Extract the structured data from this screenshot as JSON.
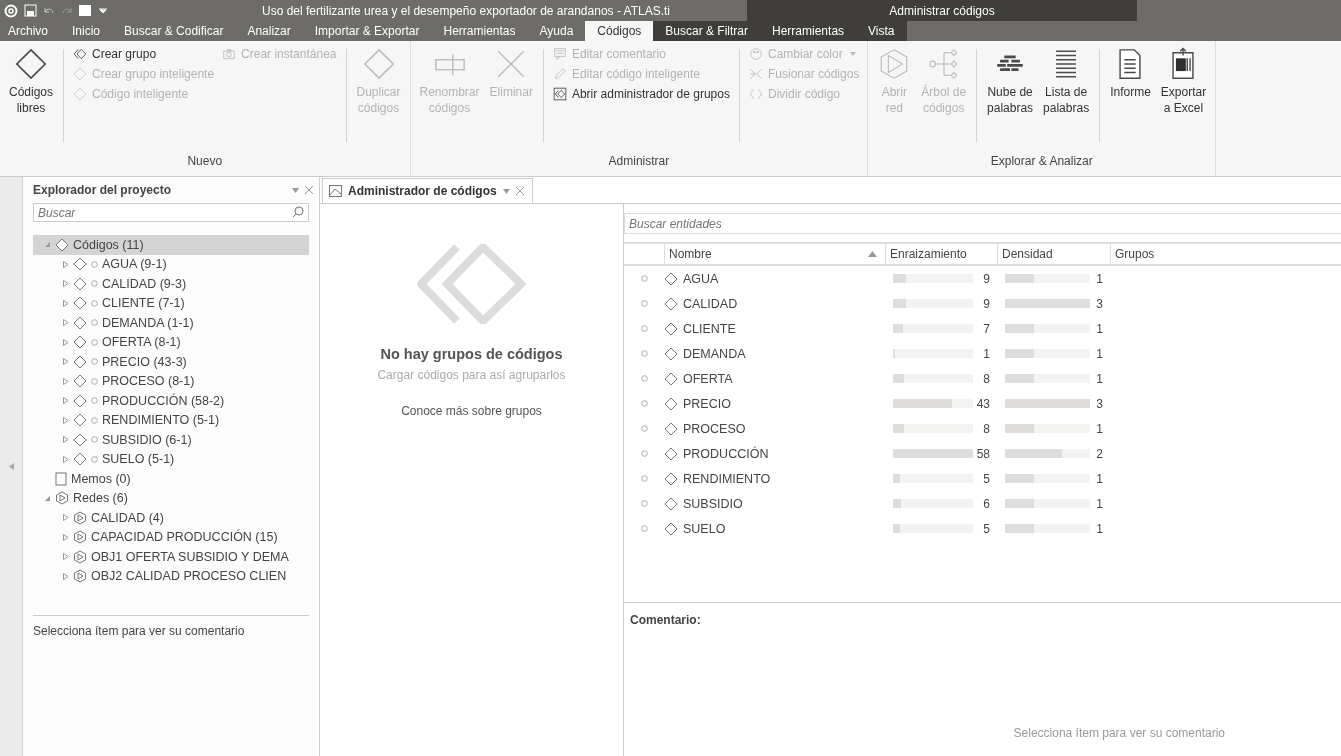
{
  "window": {
    "title": "Uso del fertilizante urea y el desempeño exportador de arandanos - ATLAS.ti",
    "context_title": "Administrar códigos"
  },
  "menu": [
    {
      "label": "Archivo",
      "selected": false,
      "context": false
    },
    {
      "label": "Inicio",
      "selected": false,
      "context": false
    },
    {
      "label": "Buscar & Codificar",
      "selected": false,
      "context": false
    },
    {
      "label": "Analizar",
      "selected": false,
      "context": false
    },
    {
      "label": "Importar & Exportar",
      "selected": false,
      "context": false
    },
    {
      "label": "Herramientas",
      "selected": false,
      "context": false
    },
    {
      "label": "Ayuda",
      "selected": false,
      "context": false
    },
    {
      "label": "Códigos",
      "selected": true,
      "context": true
    },
    {
      "label": "Buscar & Filtrar",
      "selected": false,
      "context": true
    },
    {
      "label": "Herramientas",
      "selected": false,
      "context": true
    },
    {
      "label": "Vista",
      "selected": false,
      "context": true
    }
  ],
  "ribbon": [
    {
      "label": "Nuevo",
      "columns": [
        {
          "kind": "large",
          "buttons": [
            {
              "label": "Códigos\nlibres",
              "disabled": false
            }
          ]
        },
        {
          "kind": "separator"
        },
        {
          "kind": "stack",
          "buttons": [
            {
              "label": "Crear grupo",
              "disabled": false
            },
            {
              "label": "Crear grupo inteligente",
              "disabled": true
            },
            {
              "label": "Código inteligente",
              "disabled": true
            }
          ]
        },
        {
          "kind": "stack",
          "buttons": [
            {
              "label": "Crear instantánea",
              "disabled": true
            }
          ]
        },
        {
          "kind": "separator"
        },
        {
          "kind": "large",
          "buttons": [
            {
              "label": "Duplicar\ncódigos",
              "disabled": true
            }
          ]
        }
      ]
    },
    {
      "label": "Administrar",
      "columns": [
        {
          "kind": "large",
          "buttons": [
            {
              "label": "Renombrar\ncódigos",
              "disabled": true
            }
          ]
        },
        {
          "kind": "large",
          "buttons": [
            {
              "label": "Eliminar",
              "disabled": true
            }
          ]
        },
        {
          "kind": "separator"
        },
        {
          "kind": "stack",
          "buttons": [
            {
              "label": "Editar comentario",
              "disabled": true
            },
            {
              "label": "Editar código inteligente",
              "disabled": true
            },
            {
              "label": "Abrir administrador de grupos",
              "disabled": false
            }
          ]
        },
        {
          "kind": "separator"
        },
        {
          "kind": "stack",
          "buttons": [
            {
              "label": "Cambiar color",
              "disabled": true,
              "dropdown": true
            },
            {
              "label": "Fusionar códigos",
              "disabled": true
            },
            {
              "label": "Dividir código",
              "disabled": true
            }
          ]
        }
      ]
    },
    {
      "label": "Explorar & Analizar",
      "columns": [
        {
          "kind": "large",
          "buttons": [
            {
              "label": "Abrir\nred",
              "disabled": true
            }
          ]
        },
        {
          "kind": "large",
          "buttons": [
            {
              "label": "Árbol de\ncódigos",
              "disabled": true
            }
          ]
        },
        {
          "kind": "separator"
        },
        {
          "kind": "large",
          "buttons": [
            {
              "label": "Nube de\npalabras",
              "disabled": false
            }
          ]
        },
        {
          "kind": "large",
          "buttons": [
            {
              "label": "Lista de\npalabras",
              "disabled": false
            }
          ]
        },
        {
          "kind": "separator"
        },
        {
          "kind": "large",
          "buttons": [
            {
              "label": "Informe",
              "disabled": false
            }
          ]
        },
        {
          "kind": "large",
          "buttons": [
            {
              "label": "Exportar\na Excel",
              "disabled": false
            }
          ]
        }
      ]
    }
  ],
  "explorer": {
    "title": "Explorador del proyecto",
    "search": {
      "placeholder": "Buscar"
    },
    "tree": [
      {
        "label": "Códigos (11)",
        "kind": "codes",
        "expanded": true,
        "selected": true,
        "children": [
          {
            "label": "AGUA (9-1)",
            "kind": "code",
            "expanded": false,
            "selected": false
          },
          {
            "label": "CALIDAD (9-3)",
            "kind": "code",
            "expanded": false,
            "selected": false
          },
          {
            "label": "CLIENTE (7-1)",
            "kind": "code",
            "expanded": false,
            "selected": false
          },
          {
            "label": "DEMANDA (1-1)",
            "kind": "code",
            "expanded": false,
            "selected": false
          },
          {
            "label": "OFERTA (8-1)",
            "kind": "code",
            "expanded": false,
            "selected": false
          },
          {
            "label": "PRECIO (43-3)",
            "kind": "code",
            "expanded": false,
            "selected": false
          },
          {
            "label": "PROCESO (8-1)",
            "kind": "code",
            "expanded": false,
            "selected": false
          },
          {
            "label": "PRODUCCIÓN (58-2)",
            "kind": "code",
            "expanded": false,
            "selected": false
          },
          {
            "label": "RENDIMIENTO (5-1)",
            "kind": "code",
            "expanded": false,
            "selected": false
          },
          {
            "label": "SUBSIDIO (6-1)",
            "kind": "code",
            "expanded": false,
            "selected": false
          },
          {
            "label": "SUELO (5-1)",
            "kind": "code",
            "expanded": false,
            "selected": false
          }
        ]
      },
      {
        "label": "Memos (0)",
        "kind": "memos",
        "selected": false
      },
      {
        "label": "Redes (6)",
        "kind": "networks",
        "expanded": true,
        "selected": false,
        "children": [
          {
            "label": "CALIDAD (4)",
            "kind": "network",
            "expanded": false,
            "selected": false
          },
          {
            "label": "CAPACIDAD PRODUCCIÓN (15)",
            "kind": "network",
            "expanded": false,
            "selected": false
          },
          {
            "label": "OBJ1 OFERTA SUBSIDIO Y DEMA",
            "kind": "network",
            "expanded": false,
            "selected": false
          },
          {
            "label": "OBJ2 CALIDAD PROCESO CLIEN",
            "kind": "network",
            "expanded": false,
            "selected": false
          }
        ]
      }
    ],
    "comment_placeholder": "Selecciona ítem para ver su comentario"
  },
  "document_tab": {
    "label": "Administrador de códigos",
    "selected": true
  },
  "groups_pane": {
    "title": "No hay grupos de códigos",
    "subtitle": "Cargar códigos para así agruparlos",
    "link": "Conoce más sobre grupos"
  },
  "codes_table": {
    "search": {
      "placeholder": "Buscar entidades"
    },
    "columns": [
      {
        "label": "Nombre",
        "sorted": true
      },
      {
        "label": "Enraizamiento",
        "sorted": false
      },
      {
        "label": "Densidad",
        "sorted": false
      },
      {
        "label": "Grupos",
        "sorted": false
      }
    ],
    "rows": [
      {
        "name": "AGUA",
        "selected": false,
        "rooting": {
          "value": "9",
          "level": 0.16
        },
        "density": {
          "value": "1",
          "level": 0.34
        }
      },
      {
        "name": "CALIDAD",
        "selected": false,
        "rooting": {
          "value": "9",
          "level": 0.16
        },
        "density": {
          "value": "3",
          "level": 1
        }
      },
      {
        "name": "CLIENTE",
        "selected": false,
        "rooting": {
          "value": "7",
          "level": 0.12
        },
        "density": {
          "value": "1",
          "level": 0.34
        }
      },
      {
        "name": "DEMANDA",
        "selected": false,
        "rooting": {
          "value": "1",
          "level": 0.02
        },
        "density": {
          "value": "1",
          "level": 0.34
        }
      },
      {
        "name": "OFERTA",
        "selected": false,
        "rooting": {
          "value": "8",
          "level": 0.14
        },
        "density": {
          "value": "1",
          "level": 0.34
        }
      },
      {
        "name": "PRECIO",
        "selected": false,
        "rooting": {
          "value": "43",
          "level": 0.74
        },
        "density": {
          "value": "3",
          "level": 1
        }
      },
      {
        "name": "PROCESO",
        "selected": false,
        "rooting": {
          "value": "8",
          "level": 0.14
        },
        "density": {
          "value": "1",
          "level": 0.34
        }
      },
      {
        "name": "PRODUCCIÓN",
        "selected": false,
        "rooting": {
          "value": "58",
          "level": 1
        },
        "density": {
          "value": "2",
          "level": 0.67
        }
      },
      {
        "name": "RENDIMIENTO",
        "selected": false,
        "rooting": {
          "value": "5",
          "level": 0.09
        },
        "density": {
          "value": "1",
          "level": 0.34
        }
      },
      {
        "name": "SUBSIDIO",
        "selected": false,
        "rooting": {
          "value": "6",
          "level": 0.1
        },
        "density": {
          "value": "1",
          "level": 0.34
        }
      },
      {
        "name": "SUELO",
        "selected": false,
        "rooting": {
          "value": "5",
          "level": 0.09
        },
        "density": {
          "value": "1",
          "level": 0.34
        }
      }
    ],
    "comment_label": "Comentario:",
    "comment_placeholder": "Selecciona ítem para ver su comentario"
  }
}
